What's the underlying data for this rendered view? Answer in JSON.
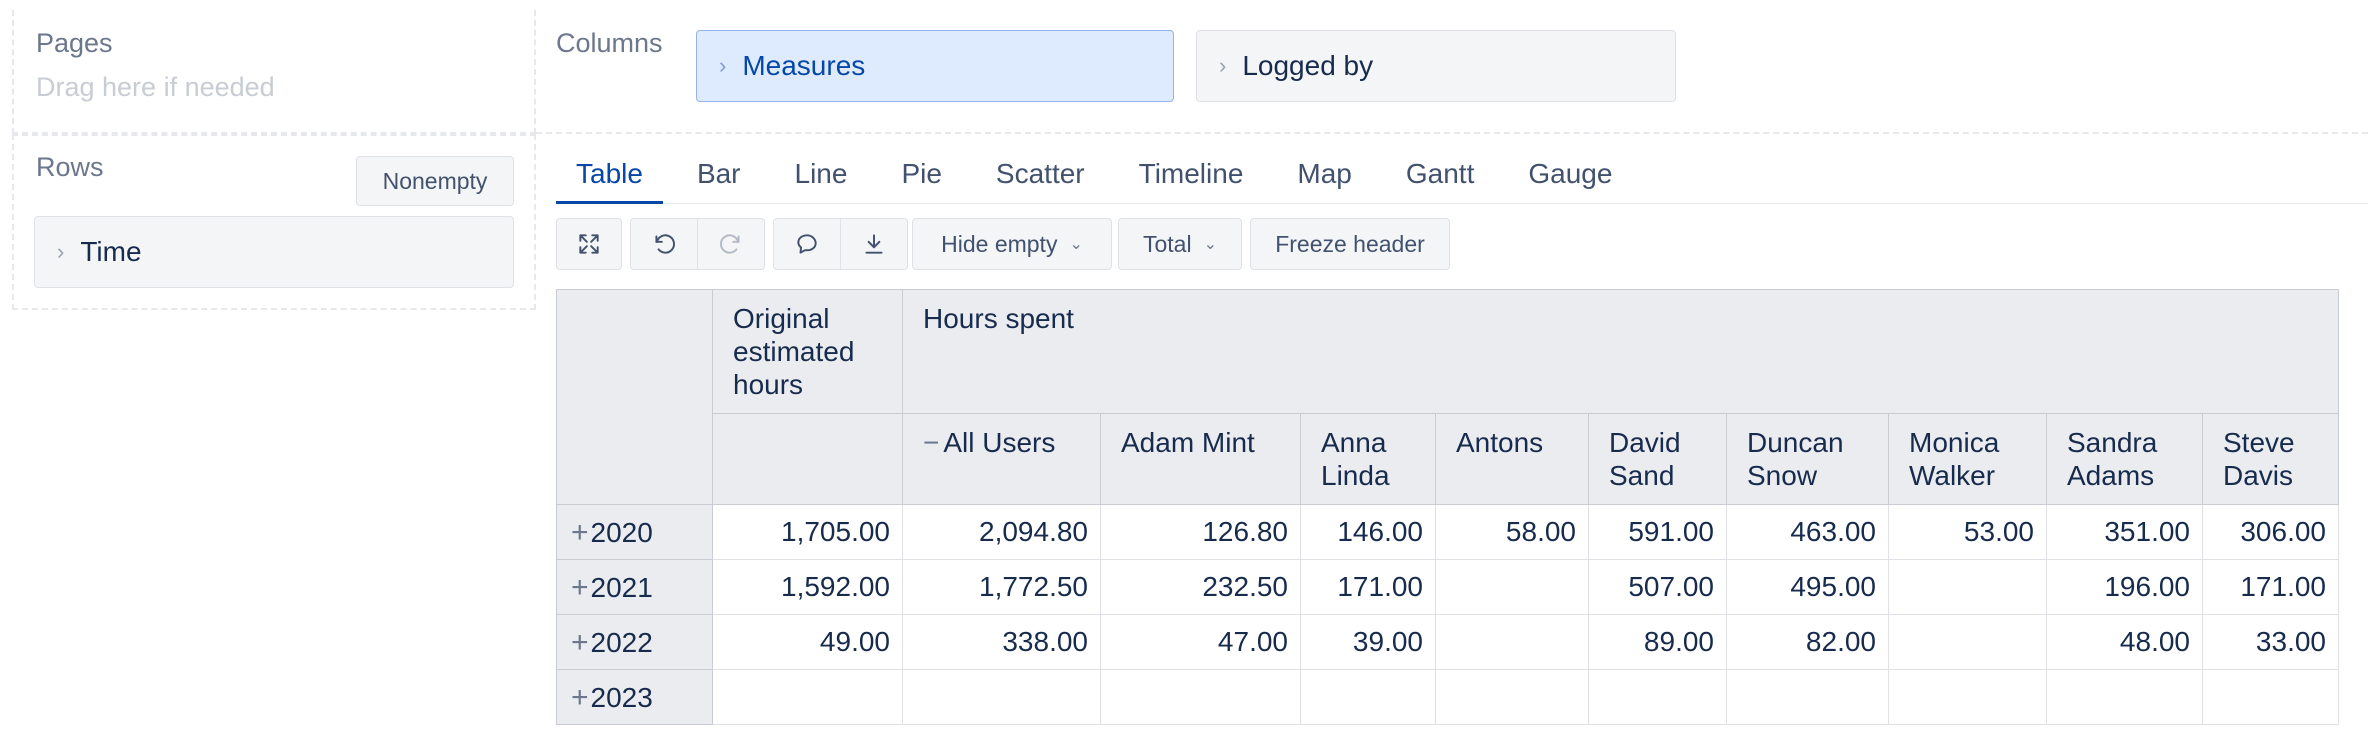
{
  "pages": {
    "title": "Pages",
    "hint": "Drag here if needed"
  },
  "columns": {
    "title": "Columns",
    "chips": [
      "Measures",
      "Logged by"
    ]
  },
  "rows": {
    "title": "Rows",
    "nonempty_label": "Nonempty",
    "chips": [
      "Time"
    ]
  },
  "tabs": [
    "Table",
    "Bar",
    "Line",
    "Pie",
    "Scatter",
    "Timeline",
    "Map",
    "Gantt",
    "Gauge"
  ],
  "active_tab": "Table",
  "toolbar": {
    "icons": [
      "expand-icon",
      "undo-icon",
      "redo-icon",
      "comment-icon",
      "download-icon"
    ],
    "hide_empty_label": "Hide empty",
    "total_label": "Total",
    "freeze_header_label": "Freeze header"
  },
  "table": {
    "measure_headers": [
      "Original estimated hours",
      "Hours spent"
    ],
    "user_headers": [
      "All Users",
      "Adam Mint",
      "Anna Linda",
      "Antons",
      "David Sand",
      "Duncan Snow",
      "Monica Walker",
      "Sandra Adams",
      "Steve Davis"
    ],
    "rows": [
      {
        "label": "2020",
        "cells": [
          "1,705.00",
          "2,094.80",
          "126.80",
          "146.00",
          "58.00",
          "591.00",
          "463.00",
          "53.00",
          "351.00",
          "306.00"
        ]
      },
      {
        "label": "2021",
        "cells": [
          "1,592.00",
          "1,772.50",
          "232.50",
          "171.00",
          "",
          "507.00",
          "495.00",
          "",
          "196.00",
          "171.00"
        ]
      },
      {
        "label": "2022",
        "cells": [
          "49.00",
          "338.00",
          "47.00",
          "39.00",
          "",
          "89.00",
          "82.00",
          "",
          "48.00",
          "33.00"
        ]
      },
      {
        "label": "2023",
        "cells": [
          "",
          "",
          "",
          "",
          "",
          "",
          "",
          "",
          "",
          ""
        ]
      }
    ]
  }
}
